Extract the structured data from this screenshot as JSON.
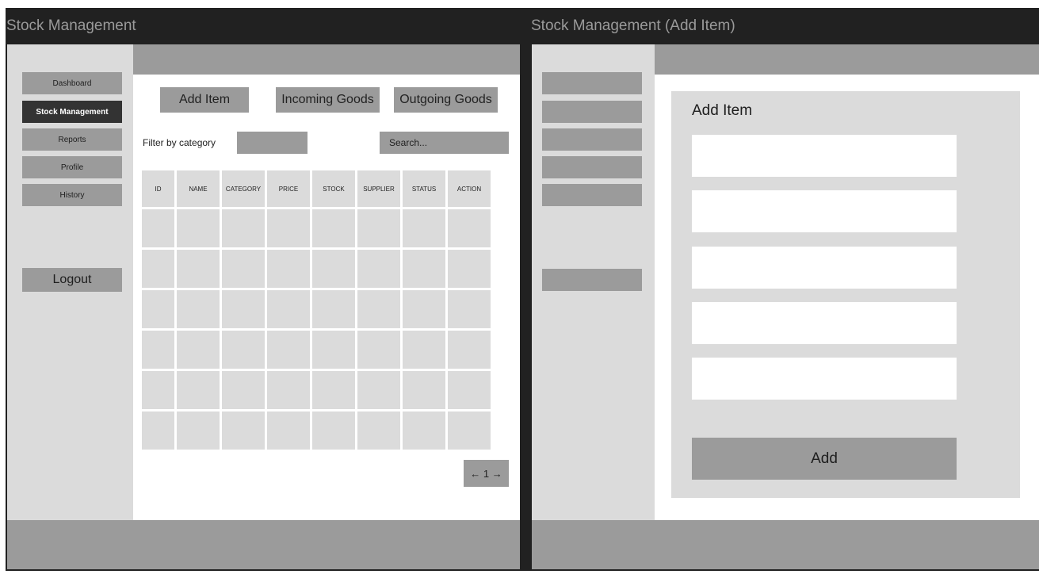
{
  "left_window": {
    "title": "Stock Management",
    "sidebar": {
      "items": [
        {
          "label": "Dashboard"
        },
        {
          "label": "Stock Management"
        },
        {
          "label": "Reports"
        },
        {
          "label": "Profile"
        },
        {
          "label": "History"
        }
      ],
      "active_item": "Stock Management",
      "logout_label": "Logout"
    },
    "toolbar": {
      "add_item_label": "Add Item",
      "incoming_goods_label": "Incoming Goods",
      "outgoing_goods_label": "Outgoing Goods"
    },
    "filter": {
      "label": "Filter by category",
      "selected_value": ""
    },
    "search": {
      "placeholder": "Search..."
    },
    "table": {
      "columns": [
        "ID",
        "NAME",
        "CATEGORY",
        "PRICE",
        "STOCK",
        "SUPPLIER",
        "STATUS",
        "ACTION"
      ],
      "row_count": 6
    },
    "pagination": {
      "label": "← 1 →"
    }
  },
  "right_window": {
    "title": "Stock Management (Add Item)",
    "form": {
      "title": "Add Item",
      "field_count": 5,
      "submit_label": "Add"
    }
  },
  "colors": {
    "window_chrome": "#212121",
    "title_text": "#9a9a9a",
    "panel_gray": "#dbdbdb",
    "control_gray": "#9b9b9b",
    "active_nav": "#333333",
    "content_bg": "#ffffff"
  }
}
